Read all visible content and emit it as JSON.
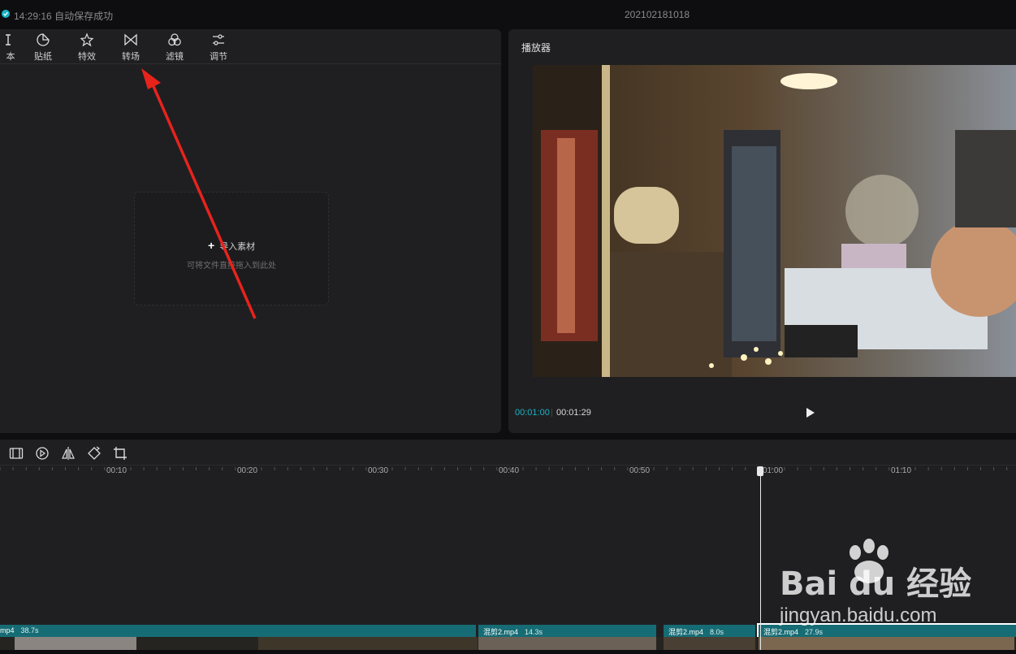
{
  "header": {
    "save_time": "14:29:16",
    "save_status": "自动保存成功",
    "project_name": "202102181018"
  },
  "toolbar": {
    "items": [
      {
        "label": "本",
        "icon": "text-icon"
      },
      {
        "label": "贴纸",
        "icon": "sticker-icon"
      },
      {
        "label": "特效",
        "icon": "effects-icon"
      },
      {
        "label": "转场",
        "icon": "transition-icon"
      },
      {
        "label": "滤镜",
        "icon": "filter-icon"
      },
      {
        "label": "调节",
        "icon": "adjust-icon"
      }
    ]
  },
  "media": {
    "import_label": "导入素材",
    "import_hint": "可将文件直接拖入到此处"
  },
  "player": {
    "title": "播放器",
    "current_time": "00:01:00",
    "total_time": "00:01:29"
  },
  "timeline": {
    "ruler_labels": [
      "00:10",
      "00:20",
      "00:30",
      "00:40",
      "00:50",
      "01:00",
      "01:10"
    ],
    "clips": [
      {
        "name": "mp4",
        "duration": "38.7s"
      },
      {
        "name": "混剪2.mp4",
        "duration": "14.3s"
      },
      {
        "name": "混剪2.mp4",
        "duration": "8.0s"
      },
      {
        "name": "混剪2.mp4",
        "duration": "27.9s"
      }
    ]
  },
  "watermark": {
    "brand": "Bai du 经验",
    "url": "jingyan.baidu.com"
  },
  "colors": {
    "accent": "#18b4c4",
    "clip": "#166c74",
    "annotation_arrow": "#e8231c"
  }
}
